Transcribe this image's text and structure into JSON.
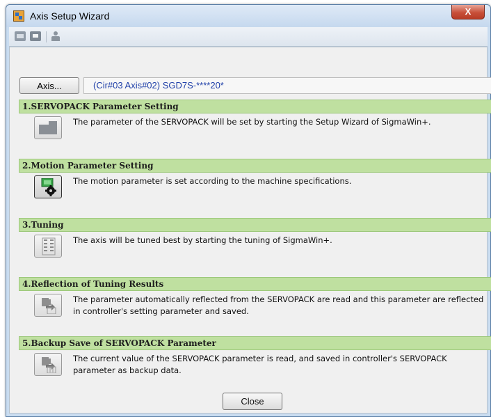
{
  "window": {
    "title": "Axis Setup Wizard",
    "close_glyph": "X"
  },
  "toolbar": {
    "icons": [
      "toolbar-grid-icon",
      "toolbar-window-icon",
      "toolbar-user-icon"
    ]
  },
  "axis": {
    "button_label": "Axis...",
    "value": "(Cir#03 Axis#02) SGD7S-****20*"
  },
  "sections": [
    {
      "header": "1.SERVOPACK Parameter Setting",
      "description": "The parameter of the SERVOPACK will be set by starting the Setup Wizard of SigmaWin+.",
      "icon": "servopack-icon"
    },
    {
      "header": "2.Motion Parameter Setting",
      "description": "The motion parameter is set according to the machine specifications.",
      "icon": "motion-gear-icon"
    },
    {
      "header": "3.Tuning",
      "description": "The axis will be tuned best by starting the tuning of SigmaWin+.",
      "icon": "tuning-icon"
    },
    {
      "header": "4.Reflection of Tuning Results",
      "description": "The parameter automatically reflected from the SERVOPACK are read and this parameter are reflected in controller's setting parameter and saved.",
      "icon": "reflection-icon"
    },
    {
      "header": "5.Backup Save of SERVOPACK Parameter",
      "description": "The current value of the SERVOPACK parameter is read, and saved in controller's SERVOPACK parameter as backup data.",
      "icon": "backup-icon"
    }
  ],
  "footer": {
    "close_label": "Close"
  },
  "colors": {
    "section_header_bg": "#bfe0a0",
    "axis_value_text": "#1f3fa8",
    "title_bar": "#c9dcf0"
  }
}
